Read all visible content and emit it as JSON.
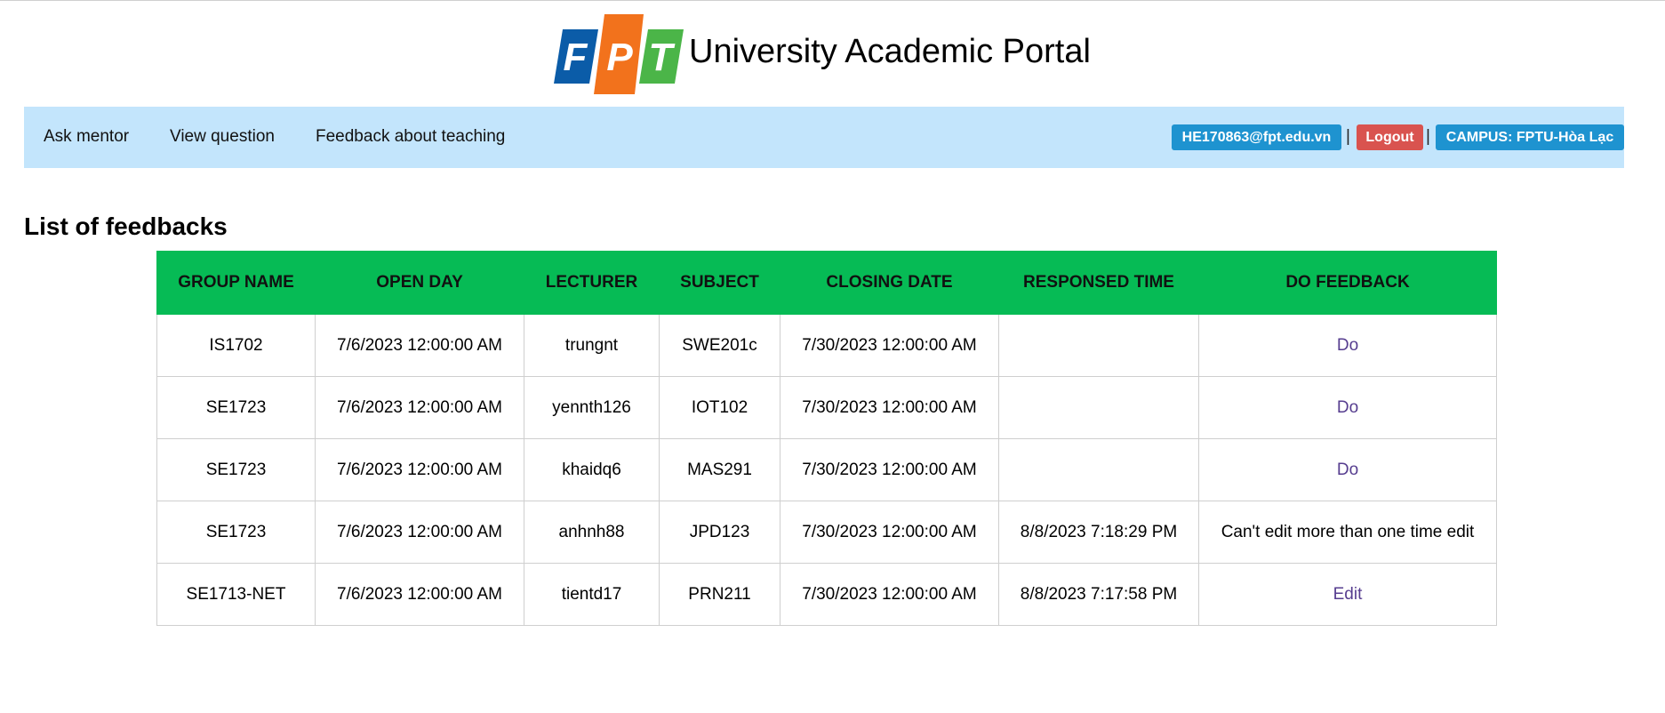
{
  "header": {
    "logo_letters": [
      "F",
      "P",
      "T"
    ],
    "logo_colors": [
      "#0b5ca8",
      "#f2721c",
      "#4bb548"
    ],
    "title": "University Academic Portal"
  },
  "nav": {
    "items": [
      {
        "label": "Ask mentor"
      },
      {
        "label": "View question"
      },
      {
        "label": "Feedback about teaching"
      }
    ],
    "user_email": "HE170863@fpt.edu.vn",
    "separator": "|",
    "logout_label": "Logout",
    "campus_label": "CAMPUS: FPTU-Hòa Lạc",
    "bar_color": "#c3e5fc",
    "badge_color": "#1e93d0",
    "logout_color": "#d9534f"
  },
  "page": {
    "title": "List of feedbacks"
  },
  "table": {
    "header_color": "#06bb55",
    "columns": [
      "GROUP NAME",
      "OPEN DAY",
      "LECTURER",
      "SUBJECT",
      "CLOSING DATE",
      "RESPONSED TIME",
      "DO FEEDBACK"
    ],
    "rows": [
      {
        "group": "IS1702",
        "open_day": "7/6/2023 12:00:00 AM",
        "lecturer": "trungnt",
        "subject": "SWE201c",
        "closing_date": "7/30/2023 12:00:00 AM",
        "responsed_time": "",
        "action": "Do",
        "action_is_link": true
      },
      {
        "group": "SE1723",
        "open_day": "7/6/2023 12:00:00 AM",
        "lecturer": "yennth126",
        "subject": "IOT102",
        "closing_date": "7/30/2023 12:00:00 AM",
        "responsed_time": "",
        "action": "Do",
        "action_is_link": true
      },
      {
        "group": "SE1723",
        "open_day": "7/6/2023 12:00:00 AM",
        "lecturer": "khaidq6",
        "subject": "MAS291",
        "closing_date": "7/30/2023 12:00:00 AM",
        "responsed_time": "",
        "action": "Do",
        "action_is_link": true
      },
      {
        "group": "SE1723",
        "open_day": "7/6/2023 12:00:00 AM",
        "lecturer": "anhnh88",
        "subject": "JPD123",
        "closing_date": "7/30/2023 12:00:00 AM",
        "responsed_time": "8/8/2023 7:18:29 PM",
        "action": "Can't edit more than one time edit",
        "action_is_link": false
      },
      {
        "group": "SE1713-NET",
        "open_day": "7/6/2023 12:00:00 AM",
        "lecturer": "tientd17",
        "subject": "PRN211",
        "closing_date": "7/30/2023 12:00:00 AM",
        "responsed_time": "8/8/2023 7:17:58 PM",
        "action": "Edit",
        "action_is_link": true
      }
    ]
  }
}
